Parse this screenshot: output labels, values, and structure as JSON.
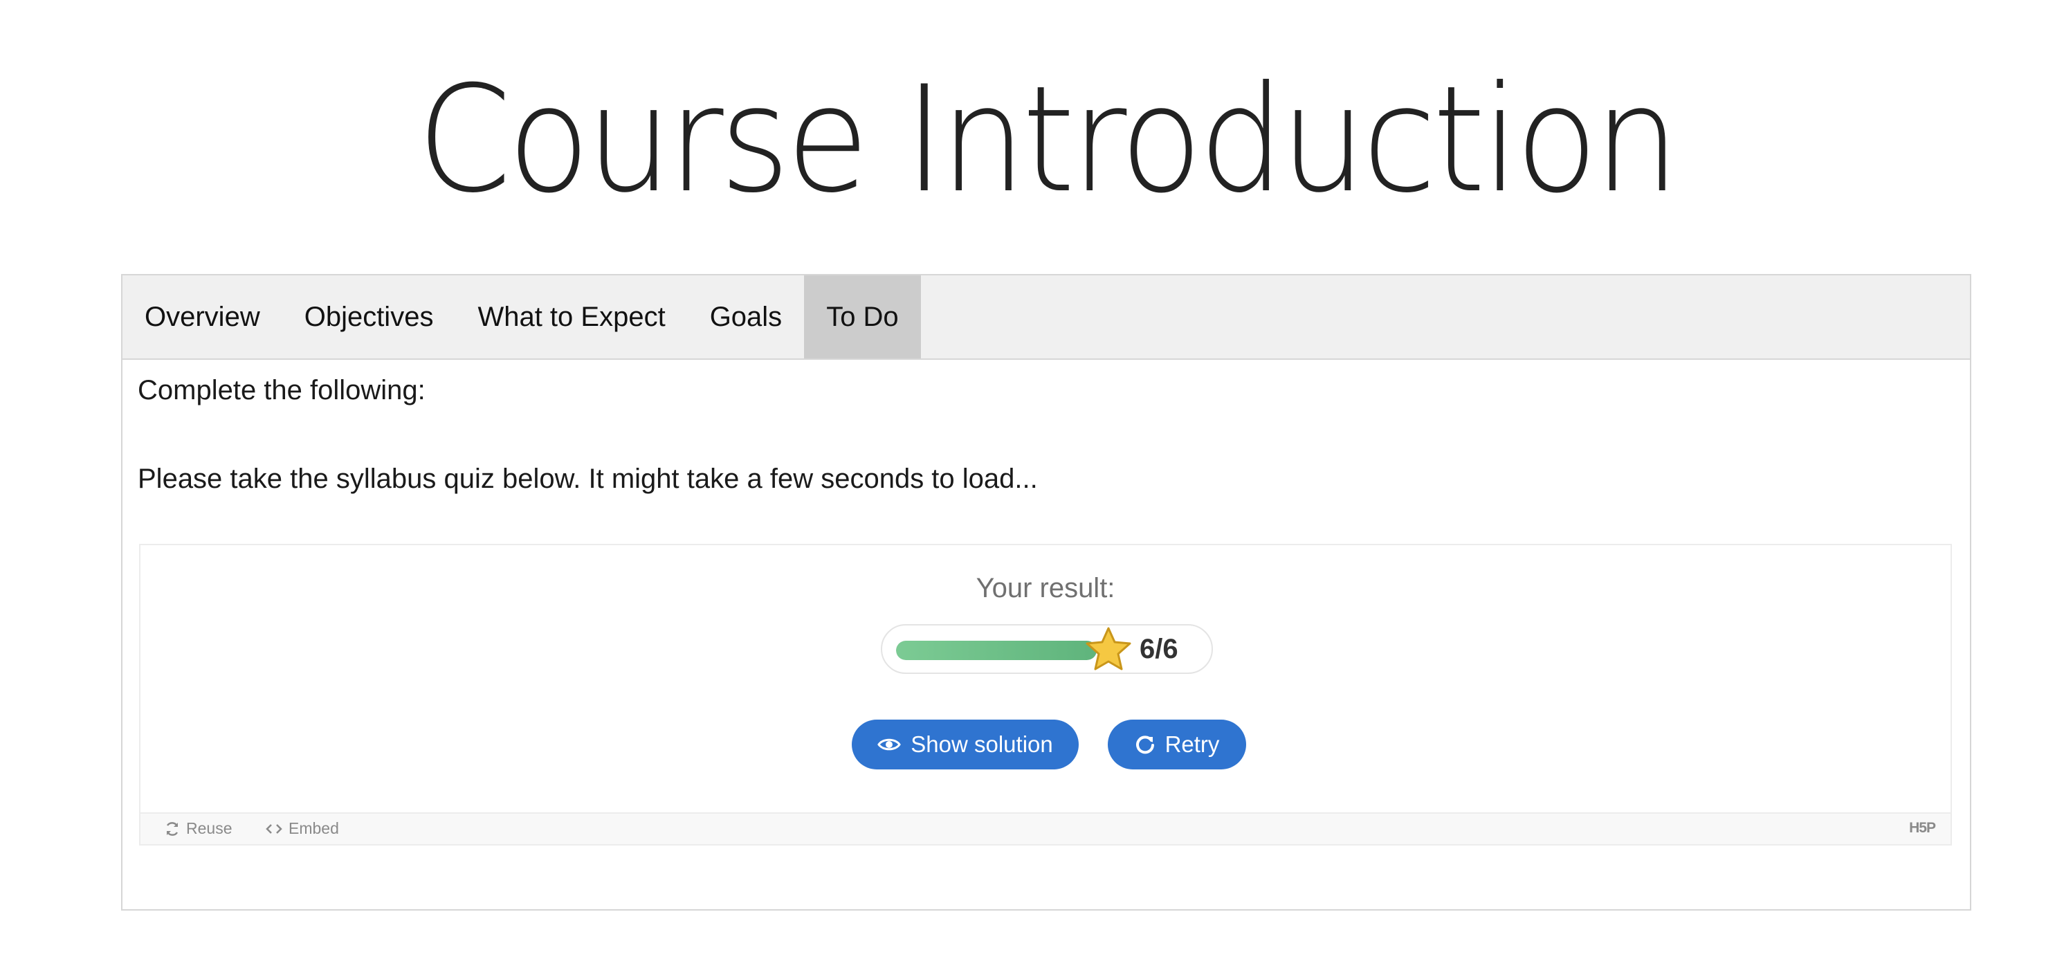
{
  "page": {
    "title": "Course Introduction"
  },
  "tabs": {
    "items": [
      {
        "label": "Overview"
      },
      {
        "label": "Objectives"
      },
      {
        "label": "What to Expect"
      },
      {
        "label": "Goals"
      },
      {
        "label": "To Do",
        "active": true
      }
    ]
  },
  "content": {
    "line1": "Complete the following:",
    "line2": "Please take the syllabus quiz below. It might take a few seconds to load..."
  },
  "quiz": {
    "result_label": "Your result:",
    "score_text": "6/6",
    "score_fraction": 1.0,
    "icons": {
      "star": "star-icon",
      "eye": "eye-icon",
      "retry": "retry-icon"
    },
    "buttons": {
      "show_solution": "Show solution",
      "retry": "Retry"
    },
    "colors": {
      "button": "#2f74d0",
      "progress": "#6bbd86",
      "star": "#f5c842"
    }
  },
  "footer": {
    "reuse": "Reuse",
    "embed": "Embed",
    "logo": "H5P",
    "icons": {
      "reuse": "reuse-icon",
      "embed": "embed-icon"
    }
  }
}
